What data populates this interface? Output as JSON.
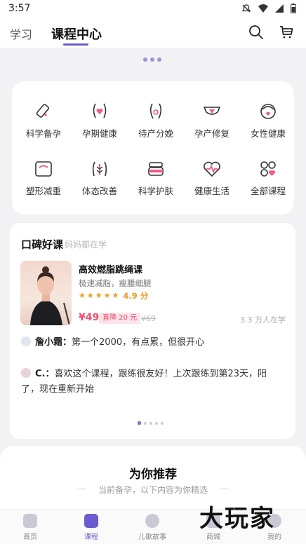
{
  "status_bar": {
    "time": "3:57"
  },
  "top_nav": {
    "tabs": [
      "学习",
      "课程中心"
    ],
    "active_tab": "课程中心"
  },
  "categories": [
    {
      "label": "科学备孕",
      "icon": "test-tube-icon"
    },
    {
      "label": "孕期健康",
      "icon": "pregnant-belly-icon"
    },
    {
      "label": "待产分娩",
      "icon": "birth-icon"
    },
    {
      "label": "孕产修复",
      "icon": "underwear-icon"
    },
    {
      "label": "女性健康",
      "icon": "woman-face-icon"
    },
    {
      "label": "塑形减重",
      "icon": "scale-icon"
    },
    {
      "label": "体态改善",
      "icon": "posture-icon"
    },
    {
      "label": "科学护肤",
      "icon": "cream-jar-icon"
    },
    {
      "label": "健康生活",
      "icon": "heart-pulse-icon"
    },
    {
      "label": "全部课程",
      "icon": "all-grid-icon"
    }
  ],
  "reviews_section": {
    "title": "口碑好课",
    "subtitle": "妈妈都在学",
    "course": {
      "title": "高效燃脂跳绳课",
      "description": "极速减脂，瘦腰细腿",
      "rating": "4.9 分",
      "stars": 5,
      "price": "¥49",
      "discount": "直降 20 元",
      "original_price": "¥69",
      "learners": "3.3 万人在学"
    },
    "comments": [
      {
        "name": "詹小霜",
        "text": "第一个2000，有点累，但很开心"
      },
      {
        "name": "C.",
        "text": "喜欢这个课程，跟练很友好！上次跟练到第23天，阳了，现在重新开始"
      }
    ]
  },
  "recommend": {
    "title": "为你推荐",
    "subtitle": "当前备孕，以下内容为你精选"
  },
  "bottom_nav": {
    "items": [
      "首页",
      "课程",
      "儿歌故事",
      "商城",
      "我的"
    ],
    "active": "课程"
  },
  "watermark": {
    "text": "大玩家"
  },
  "colors": {
    "accent": "#6a5bd1",
    "price": "#f0506e",
    "star": "#f39a1c"
  }
}
